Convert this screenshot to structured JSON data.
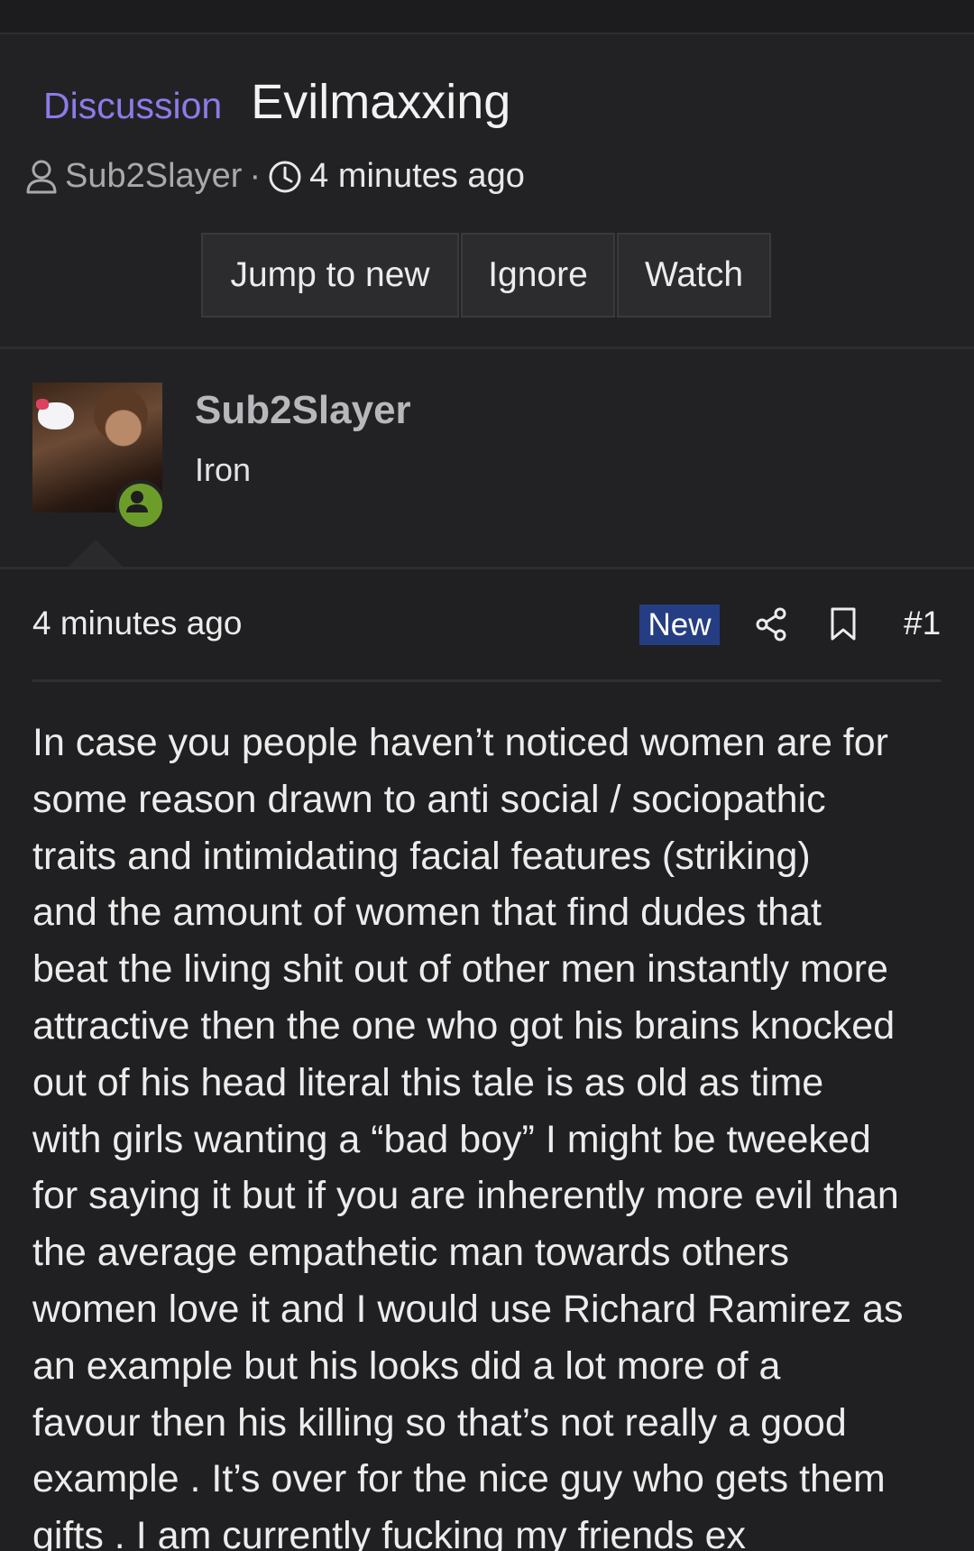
{
  "thread": {
    "prefix": "Discussion",
    "title": "Evilmaxxing",
    "author": "Sub2Slayer",
    "separator": "·",
    "time": "4 minutes ago"
  },
  "actions": {
    "jump_to_new": "Jump to new",
    "ignore": "Ignore",
    "watch": "Watch"
  },
  "user": {
    "name": "Sub2Slayer",
    "title": "Iron",
    "status": "online"
  },
  "post": {
    "time": "4 minutes ago",
    "badge": "New",
    "number": "#1",
    "body": "In case you people haven’t noticed women are for\nsome reason drawn to anti social / sociopathic\ntraits and intimidating facial features (striking)\nand the amount of women that find dudes that\nbeat the living shit out of other men instantly more\nattractive then the one who got his brains knocked\nout of his head literal this tale is as old as time\nwith girls wanting a “bad boy” I might be tweeked\nfor saying it but if you are inherently more evil than\nthe average empathetic man towards others\nwomen love it and I would use Richard Ramirez as\nan example but his looks did a lot more of a\nfavour then his killing so that’s not really a good\nexample . It’s over for the nice guy who gets them\ngifts . I am currently fucking my friends ex"
  },
  "colors": {
    "background": "#202022",
    "prefix": "#8d7bea",
    "new_badge": "#253d83",
    "online": "#6c9d2a"
  }
}
